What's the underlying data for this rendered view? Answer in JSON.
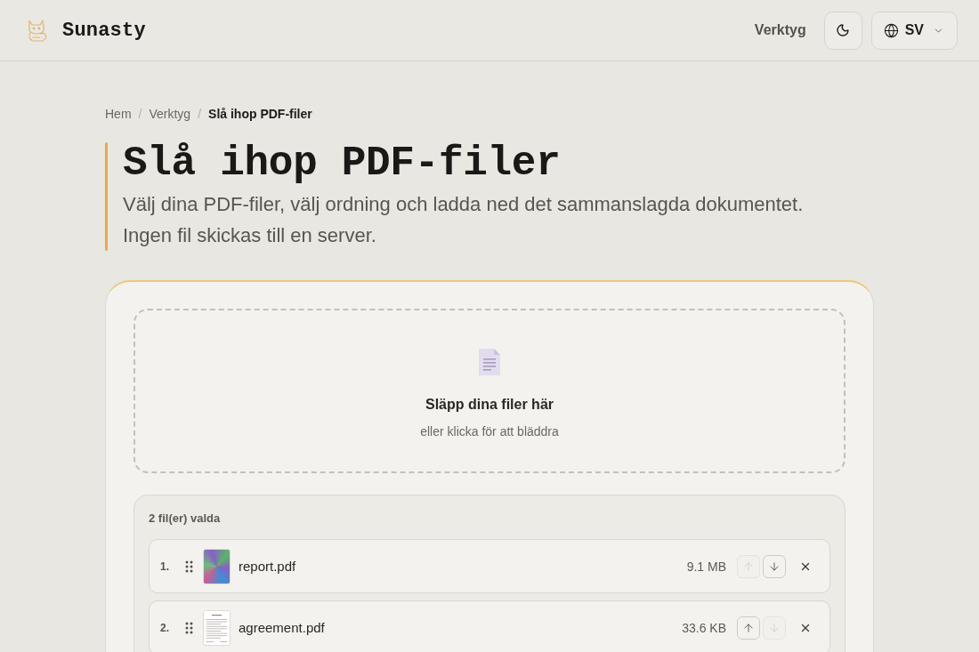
{
  "header": {
    "brand": "Sunasty",
    "nav": [
      {
        "label": "Verktyg"
      }
    ],
    "language": {
      "label": "SV"
    }
  },
  "breadcrumb": [
    {
      "label": "Hem",
      "current": false,
      "separator": "/"
    },
    {
      "label": "Verktyg",
      "current": false,
      "separator": "/"
    },
    {
      "label": "Slå ihop PDF-filer",
      "current": true
    }
  ],
  "page": {
    "title": "Slå ihop PDF-filer",
    "description": "Välj dina PDF-filer, välj ordning och ladda ned det sammanslagda dokumentet. Ingen fil skickas till en server."
  },
  "dropzone": {
    "title": "Släpp dina filer här",
    "hint": "eller klicka för att bläddra"
  },
  "file_list": {
    "count_label": "2 fil(er) valda",
    "files": [
      {
        "kind": "image",
        "index": "1.",
        "name": "report.pdf",
        "size": "9.1 MB",
        "up_disabled": true,
        "down_disabled": false
      },
      {
        "kind": "document",
        "index": "2.",
        "name": "agreement.pdf",
        "size": "33.6 KB",
        "up_disabled": false,
        "down_disabled": true
      }
    ]
  }
}
